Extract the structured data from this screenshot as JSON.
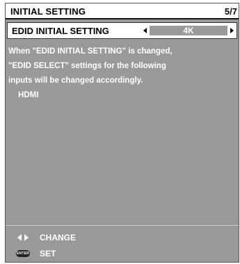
{
  "header": {
    "title": "INITIAL SETTING",
    "page": "5/7"
  },
  "setting": {
    "label": "EDID INITIAL SETTING",
    "value": "4K"
  },
  "message": {
    "line1": "When \"EDID INITIAL SETTING\" is changed,",
    "line2": "\"EDID SELECT\" settings for the following",
    "line3": "inputs will be changed accordingly.",
    "input": "HDMI"
  },
  "footer": {
    "change_label": "CHANGE",
    "set_label": "SET",
    "enter_icon_text": "ENTER",
    "change_icon": "left-right-arrows-icon",
    "set_icon": "enter-button-icon"
  },
  "colors": {
    "panel_background": "#999999",
    "header_background": "#ffffff",
    "text_light": "#ffffff"
  }
}
